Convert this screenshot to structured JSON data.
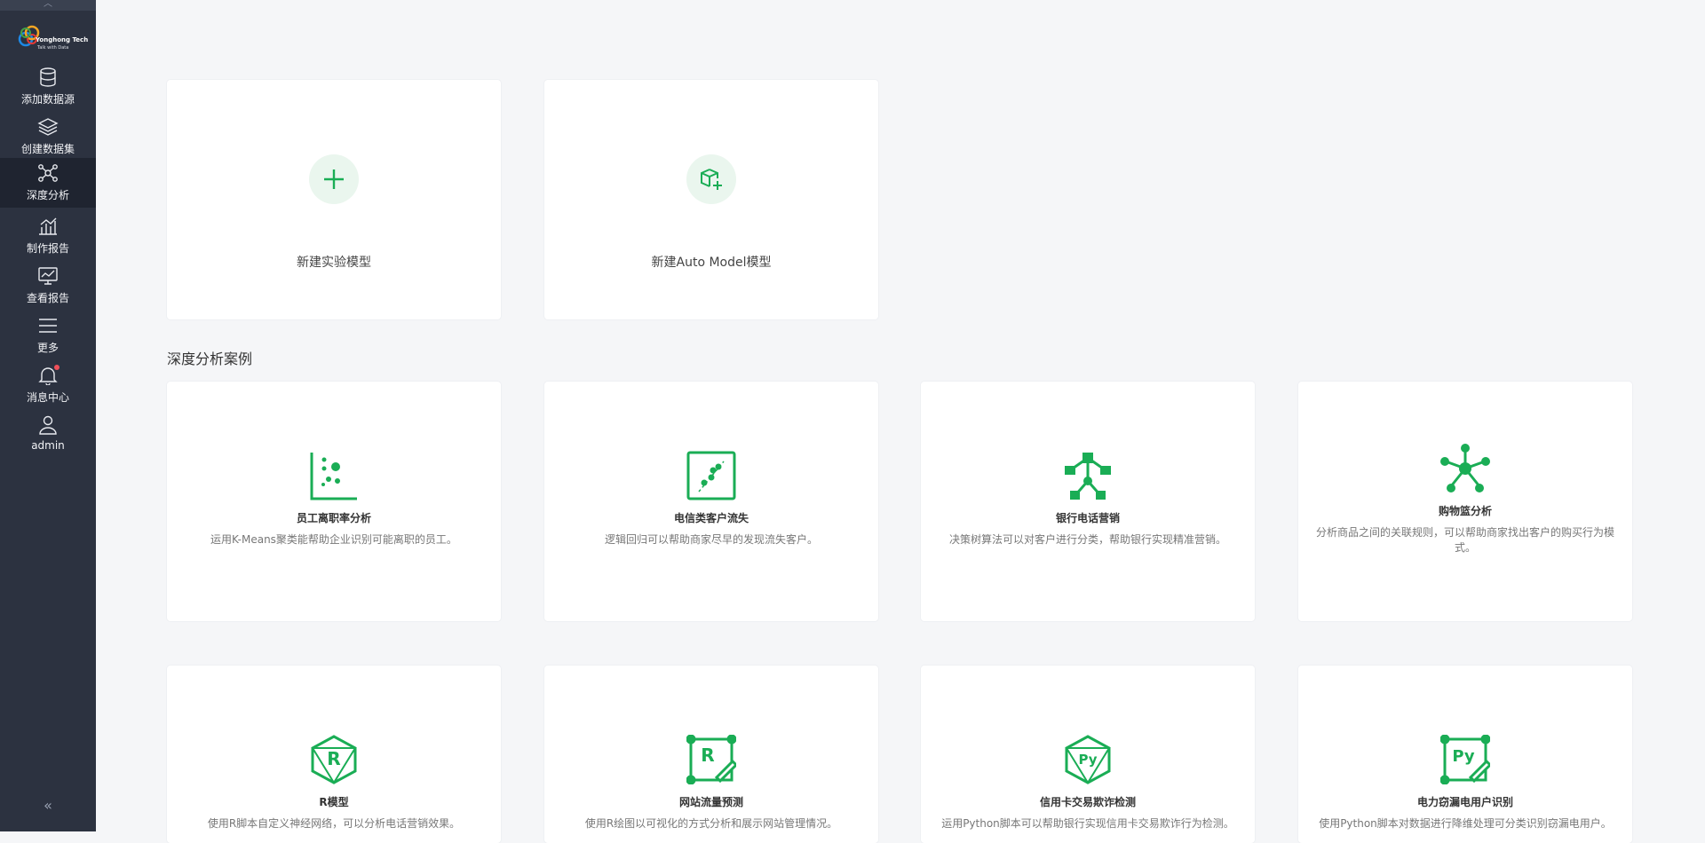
{
  "app": {
    "logo_title": "Yonghong Tech",
    "logo_subtitle": "Talk with Data"
  },
  "sidebar": {
    "items": [
      {
        "label": "添加数据源",
        "icon": "database-icon"
      },
      {
        "label": "创建数据集",
        "icon": "layers-icon"
      },
      {
        "label": "深度分析",
        "icon": "network-icon",
        "active": true
      },
      {
        "label": "制作报告",
        "icon": "bar-chart-icon"
      },
      {
        "label": "查看报告",
        "icon": "monitor-chart-icon"
      },
      {
        "label": "更多",
        "icon": "menu-icon"
      },
      {
        "label": "消息中心",
        "icon": "bell-icon",
        "has_badge": true
      },
      {
        "label": "admin",
        "icon": "user-icon"
      }
    ],
    "collapse_icon": "double-chevron-left-icon"
  },
  "create": {
    "experiment_label": "新建实验模型",
    "automodel_label": "新建Auto Model模型"
  },
  "cases": {
    "section_title": "深度分析案例",
    "items": [
      {
        "title": "员工离职率分析",
        "desc": "运用K-Means聚类能帮助企业识别可能离职的员工。",
        "icon": "scatter-plot-icon"
      },
      {
        "title": "电信类客户流失",
        "desc": "逻辑回归可以帮助商家尽早的发现流失客户。",
        "icon": "regression-chart-icon"
      },
      {
        "title": "银行电话营销",
        "desc": "决策树算法可以对客户进行分类，帮助银行实现精准营销。",
        "icon": "decision-tree-icon"
      },
      {
        "title": "购物篮分析",
        "desc": "分析商品之间的关联规则，可以帮助商家找出客户的购买行为模式。",
        "icon": "association-network-icon"
      },
      {
        "title": "R模型",
        "desc": "使用R脚本自定义神经网络，可以分析电话营销效果。",
        "icon": "r-hexagon-icon"
      },
      {
        "title": "网站流量预测",
        "desc": "使用R绘图以可视化的方式分析和展示网站管理情况。",
        "icon": "r-edit-icon"
      },
      {
        "title": "信用卡交易欺诈检测",
        "desc": "运用Python脚本可以帮助银行实现信用卡交易欺诈行为检测。",
        "icon": "python-hexagon-icon"
      },
      {
        "title": "电力窃漏电用户识别",
        "desc": "使用Python脚本对数据进行降维处理可分类识别窃漏电用户。",
        "icon": "python-edit-icon"
      }
    ]
  },
  "colors": {
    "accent": "#1aad55",
    "sidebar_bg": "#2c3240",
    "sidebar_active": "#1f2430",
    "page_bg": "#f5f6f8"
  }
}
